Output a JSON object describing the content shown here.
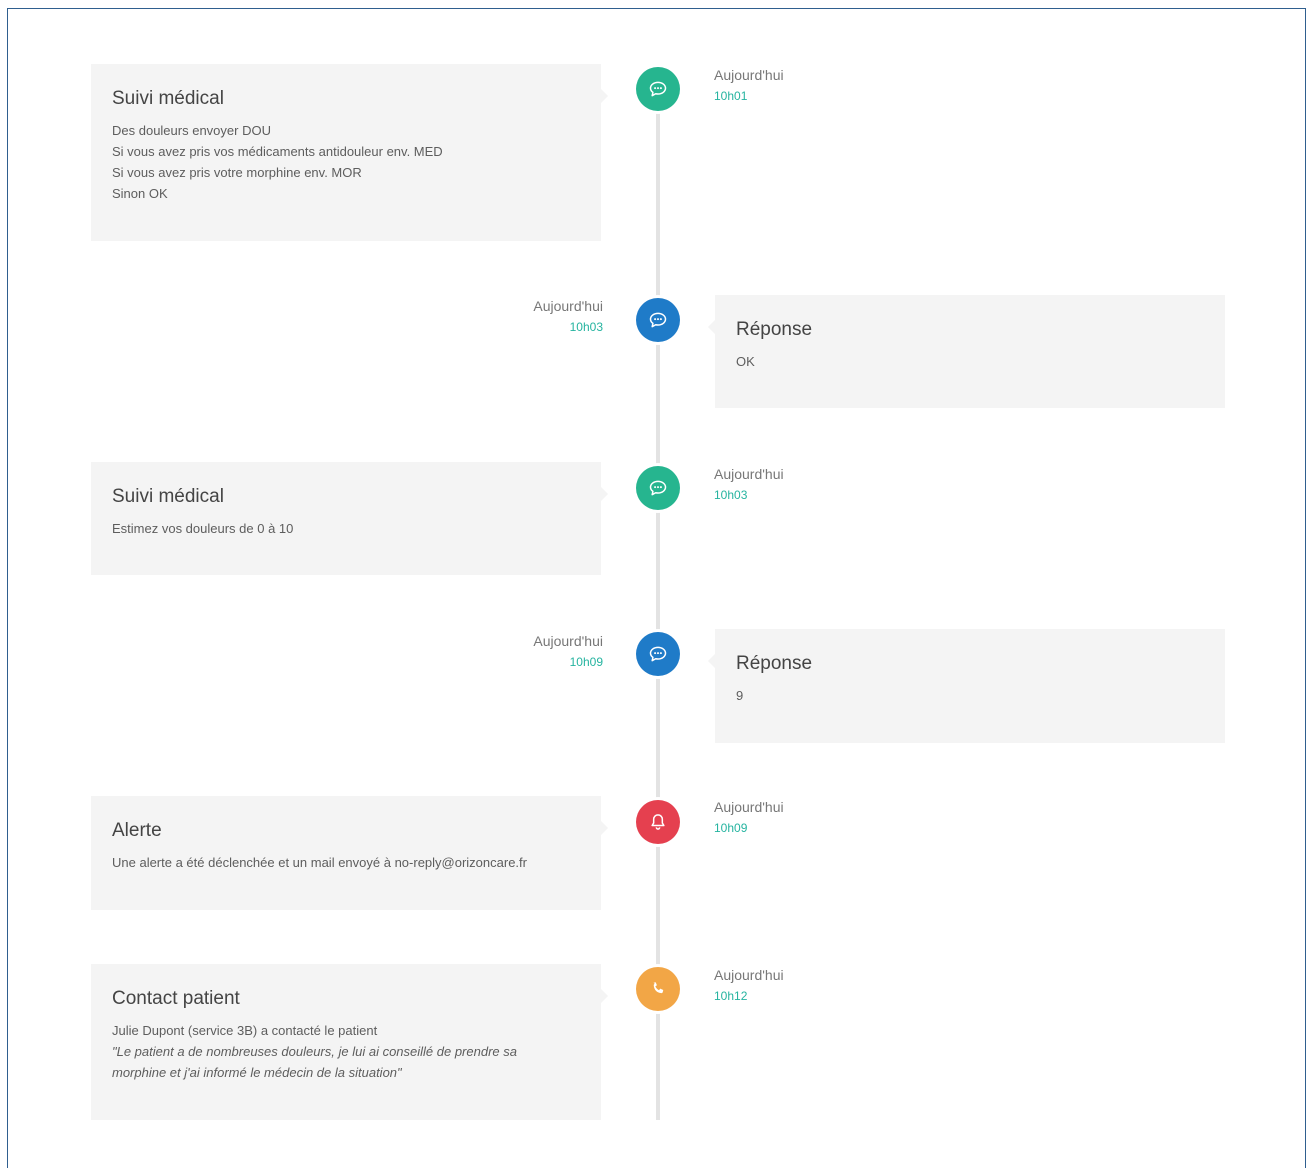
{
  "colors": {
    "green": "#26b58f",
    "blue": "#1f7bc8",
    "red": "#e5404f",
    "orange": "#f2a646",
    "time_teal": "#26b4a0"
  },
  "events": [
    {
      "side": "left",
      "icon": "chat-bubble-icon",
      "color": "green",
      "title": "Suivi médical",
      "lines": [
        "Des douleurs envoyer DOU",
        "Si vous avez pris vos médicaments antidouleur env. MED",
        "Si vous avez pris votre morphine env. MOR",
        "Sinon OK"
      ],
      "day": "Aujourd'hui",
      "hour": "10h01"
    },
    {
      "side": "right",
      "icon": "chat-bubble-icon",
      "color": "blue",
      "title": "Réponse",
      "lines": [
        "OK"
      ],
      "day": "Aujourd'hui",
      "hour": "10h03"
    },
    {
      "side": "left",
      "icon": "chat-bubble-icon",
      "color": "green",
      "title": "Suivi médical",
      "lines": [
        "Estimez vos douleurs de 0 à 10"
      ],
      "day": "Aujourd'hui",
      "hour": "10h03"
    },
    {
      "side": "right",
      "icon": "chat-bubble-icon",
      "color": "blue",
      "title": "Réponse",
      "lines": [
        "9"
      ],
      "day": "Aujourd'hui",
      "hour": "10h09"
    },
    {
      "side": "left",
      "icon": "bell-icon",
      "color": "red",
      "title": "Alerte",
      "lines": [
        "Une alerte a été déclenchée et un mail envoyé à no-reply@orizoncare.fr"
      ],
      "day": "Aujourd'hui",
      "hour": "10h09"
    },
    {
      "side": "left",
      "icon": "phone-icon",
      "color": "orange",
      "title": "Contact patient",
      "lines": [
        "Julie Dupont (service 3B) a contacté le patient",
        "\"Le patient a de nombreuses douleurs, je lui ai conseillé de prendre sa",
        "morphine et j'ai informé le médecin de la situation\""
      ],
      "day": "Aujourd'hui",
      "hour": "10h12"
    }
  ]
}
